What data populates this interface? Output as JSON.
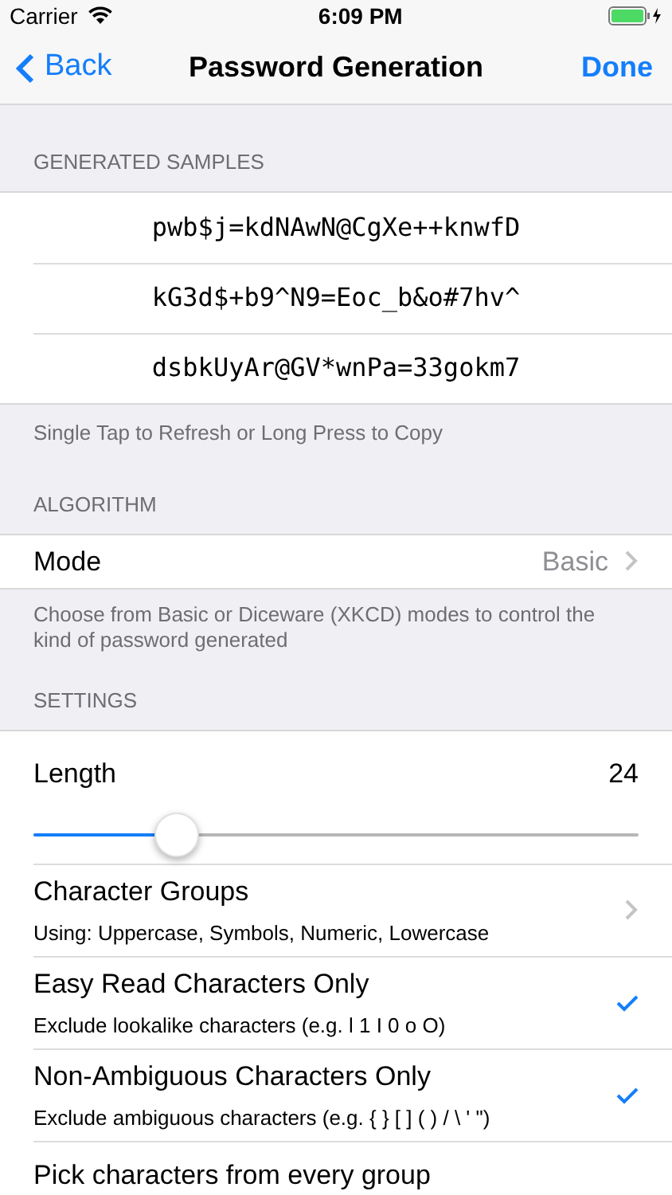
{
  "status_bar": {
    "carrier": "Carrier",
    "time": "6:09 PM"
  },
  "nav": {
    "back": "Back",
    "title": "Password Generation",
    "done": "Done"
  },
  "samples": {
    "header": "GENERATED SAMPLES",
    "items": [
      "pwb$j=kdNAwN@CgXe++knwfD",
      "kG3d$+b9^N9=Eoc_b&o#7hv^",
      "dsbkUyAr@GV*wnPa=33gokm7"
    ],
    "footer": "Single Tap to Refresh or Long Press to Copy"
  },
  "algorithm": {
    "header": "ALGORITHM",
    "mode_label": "Mode",
    "mode_value": "Basic",
    "footer": "Choose from Basic or Diceware (XKCD) modes to control the kind of password generated"
  },
  "settings": {
    "header": "SETTINGS",
    "length_label": "Length",
    "length_value": "24",
    "level": 0.237,
    "rows": [
      {
        "kind": "disclosure",
        "title": "Character Groups",
        "subtitle": "Using: Uppercase, Symbols, Numeric, Lowercase"
      },
      {
        "kind": "check",
        "title": "Easy Read Characters Only",
        "subtitle": "Exclude lookalike characters (e.g. l 1 I 0 o O)",
        "checked": true
      },
      {
        "kind": "check",
        "title": "Non-Ambiguous Characters Only",
        "subtitle": "Exclude ambiguous characters (e.g. { } [ ] ( ) / \\ ' \")",
        "checked": true
      },
      {
        "kind": "cut",
        "title": "Pick characters from every group"
      }
    ]
  }
}
